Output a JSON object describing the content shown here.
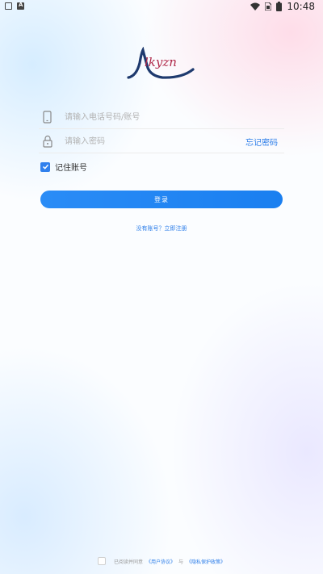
{
  "status_bar": {
    "time": "10:48",
    "icons": [
      "notification-icon",
      "app-a-icon",
      "wifi-icon",
      "sim-icon",
      "battery-icon"
    ]
  },
  "logo": {
    "text": "lkyzn"
  },
  "form": {
    "phone_placeholder": "请输入电话号码/账号",
    "password_placeholder": "请输入密码",
    "forgot_label": "忘记密码",
    "remember_label": "记住账号",
    "remember_checked": true,
    "login_label": "登录",
    "register_link": "没有账号？立即注册"
  },
  "agreement": {
    "prefix": "已阅读并同意",
    "user_agreement": "《用户协议》",
    "and": "与",
    "privacy_policy": "《隐私保护政策》"
  },
  "colors": {
    "accent": "#2b7de9",
    "logo_arc": "#1e3a6e",
    "logo_text": "#b02a4a"
  }
}
